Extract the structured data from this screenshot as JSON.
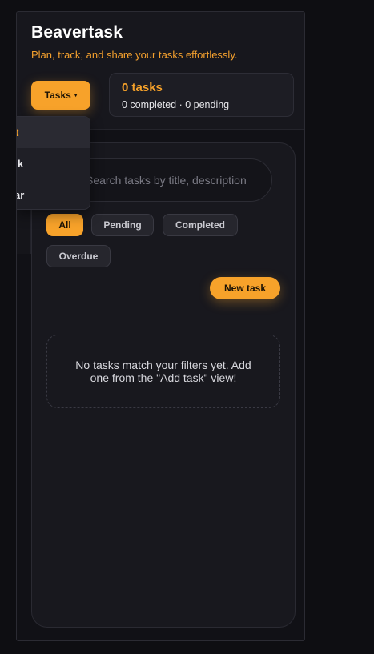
{
  "app": {
    "title": "Beavertask",
    "subtitle": "Plan, track, and share your tasks effortlessly."
  },
  "nav": {
    "menu_button_label": "Tasks",
    "menu_caret": "▾",
    "dropdown_items": [
      {
        "label": "t",
        "active": true
      },
      {
        "label": "k",
        "active": false
      },
      {
        "label": "ar",
        "active": false
      }
    ]
  },
  "summary": {
    "count": "0 tasks",
    "detail": "0 completed · 0 pending"
  },
  "search": {
    "placeholder": "Search tasks by title, description",
    "value": "",
    "icon": "search-icon"
  },
  "filters": [
    {
      "label": "All",
      "active": true
    },
    {
      "label": "Pending",
      "active": false
    },
    {
      "label": "Completed",
      "active": false
    },
    {
      "label": "Overdue",
      "active": false
    }
  ],
  "actions": {
    "new_task_label": "New task"
  },
  "empty_state": {
    "message": "No tasks match your filters yet. Add one from the \"Add task\" view!"
  },
  "colors": {
    "accent": "#f7a22a",
    "background": "#0e0e12",
    "panel": "#18181e"
  }
}
